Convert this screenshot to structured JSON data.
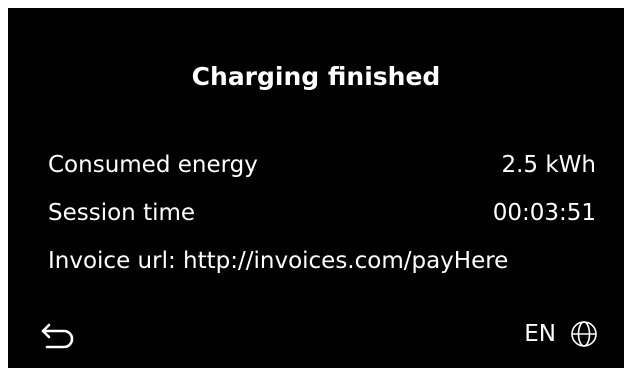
{
  "screen": {
    "title": "Charging finished",
    "rows": [
      {
        "label": "Consumed energy",
        "value": "2.5 kWh"
      },
      {
        "label": "Session time",
        "value": "00:03:51"
      },
      {
        "label": "Invoice url: http://invoices.com/payHere",
        "value": ""
      }
    ],
    "back_icon": "back-arrow-icon",
    "language": {
      "code": "EN",
      "icon": "globe-icon"
    }
  },
  "colors": {
    "background": "#000000",
    "text": "#ffffff",
    "frame": "#ffffff"
  }
}
